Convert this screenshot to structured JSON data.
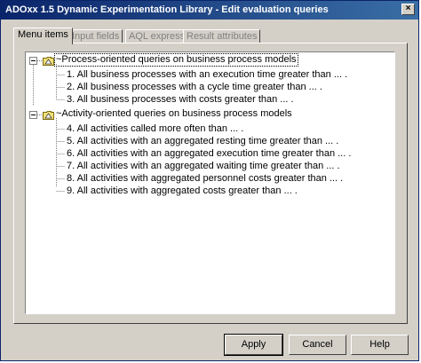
{
  "window": {
    "title": "ADOxx 1.5 Dynamic Experimentation Library - Edit evaluation queries",
    "close_glyph": "×"
  },
  "tabs": [
    {
      "label": "Menu items",
      "active": true
    },
    {
      "label": "Input fields",
      "active": false
    },
    {
      "label": "AQL expressions",
      "active": false
    },
    {
      "label": "Result attributes",
      "active": false
    }
  ],
  "tree": {
    "groups": [
      {
        "label": "~Process-oriented queries on business process models",
        "icon": "folder-icon",
        "items": [
          "1. All business processes with an execution time greater than ... .",
          "2. All business processes with a cycle time greater than ... .",
          "3. All business processes with costs greater than ... ."
        ]
      },
      {
        "label": "~Activity-oriented queries on business process models",
        "icon": "folder-icon",
        "items": [
          "4. All activities called more often than ... .",
          "5. All activities with an aggregated resting time greater than ... .",
          "6. All activities with an aggregated execution time greater than ... .",
          "7. All activities with an aggregated waiting time greater than ... .",
          "8. All activities with aggregated personnel costs greater than ... .",
          "9. All activities with aggregated costs greater than ... ."
        ]
      }
    ]
  },
  "buttons": {
    "apply": "Apply",
    "cancel": "Cancel",
    "help": "Help"
  },
  "colors": {
    "titlebar_start": "#0a246a",
    "titlebar_end": "#3a6ea5",
    "dialog_face": "#d4d0c8",
    "folder_yellow": "#f3e07a"
  }
}
